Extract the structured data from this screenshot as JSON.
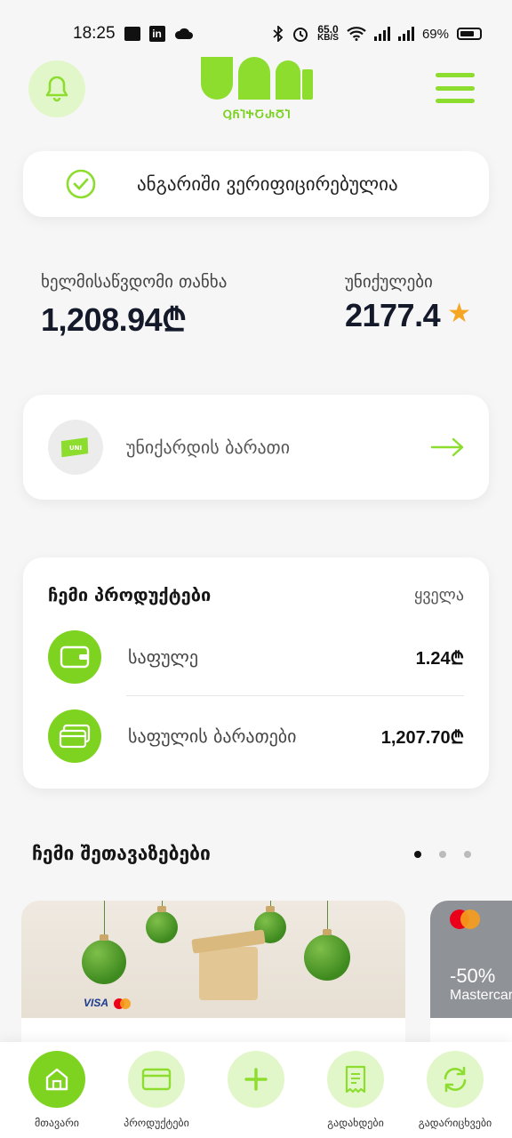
{
  "status_bar": {
    "time": "18:25",
    "net_speed": "65.0",
    "net_unit": "KB/S",
    "battery": "69%"
  },
  "header": {
    "logo_text": "ႳႬႨႵႠႰႣႨ",
    "icons": [
      "bell-icon",
      "menu-icon"
    ]
  },
  "verified": {
    "text": "ანგარიში ვერიფიცირებულია"
  },
  "balance": {
    "available_label": "ხელმისაწვდომი თანხა",
    "available_value": "1,208.94₾",
    "points_label": "უნიქულები",
    "points_value": "2177.4"
  },
  "unicard": {
    "label": "უნიქარდის ბარათი"
  },
  "products": {
    "title": "ჩემი პროდუქტები",
    "all_link": "ყველა",
    "items": [
      {
        "name": "საფულე",
        "value": "1.24₾",
        "icon": "wallet-icon"
      },
      {
        "name": "საფულის ბარათები",
        "value": "1,207.70₾",
        "icon": "cards-icon"
      }
    ]
  },
  "offers": {
    "title": "ჩემი შეთავაზებები",
    "page_count": 3,
    "active_page": 1,
    "second_card": {
      "discount": "-50%",
      "brand": "Mastercard"
    },
    "visa_text": "VISA"
  },
  "bottom_nav": {
    "items": [
      {
        "label": "მთავარი",
        "icon": "home-icon",
        "active": true
      },
      {
        "label": "პროდუქტები",
        "icon": "card-icon",
        "active": false
      },
      {
        "label": "",
        "icon": "plus-icon",
        "active": false
      },
      {
        "label": "გადახდები",
        "icon": "receipt-icon",
        "active": false
      },
      {
        "label": "გადარიცხვები",
        "icon": "transfer-icon",
        "active": false
      }
    ]
  },
  "colors": {
    "accent": "#7ed321",
    "accent_light": "#e2f7c9",
    "star": "#f5a623",
    "background": "#f6f6f6"
  }
}
